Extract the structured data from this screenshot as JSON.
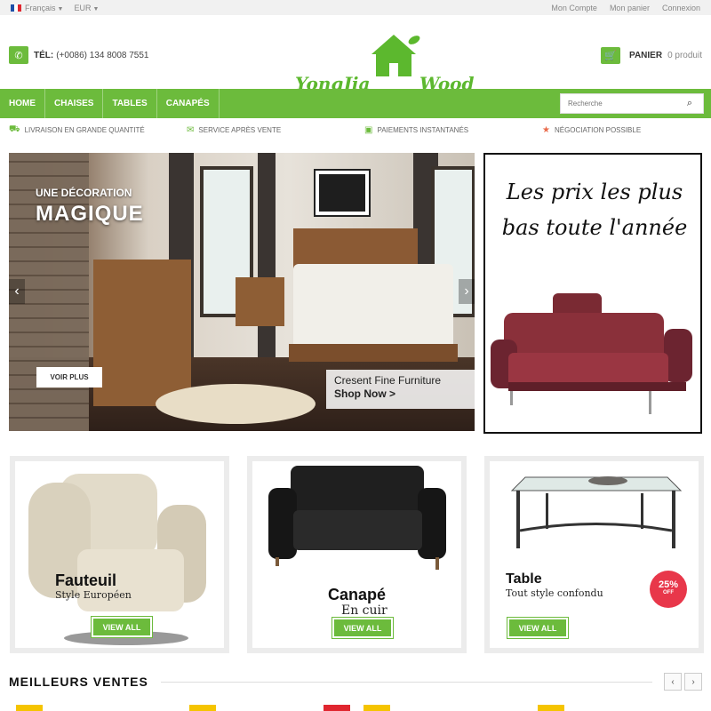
{
  "topbar": {
    "language": "Français",
    "currency": "EUR",
    "links": [
      "Mon Compte",
      "Mon panier",
      "Connexion"
    ]
  },
  "header": {
    "phone_label": "TÉL:",
    "phone_number": "(+0086) 134 8008 7551",
    "logo_text": "YongJia Wood",
    "cart_label": "PANIER",
    "cart_count": "0 produit"
  },
  "nav": {
    "items": [
      "HOME",
      "CHAISES",
      "TABLES",
      "CANAPÉS"
    ],
    "search_placeholder": "Recherche"
  },
  "features": [
    {
      "icon": "truck-icon",
      "label": "LIVRAISON EN GRANDE QUANTITÉ"
    },
    {
      "icon": "chat-icon",
      "label": "SERVICE APRÈS VENTE"
    },
    {
      "icon": "money-icon",
      "label": "PAIEMENTS INSTANTANÉS"
    },
    {
      "icon": "star-icon",
      "label": "NÉGOCIATION POSSIBLE"
    }
  ],
  "banner": {
    "small_title": "UNE DÉCORATION",
    "big_title": "MAGIQUE",
    "button": "VOIR PLUS",
    "brand_line1": "Cresent Fine Furniture",
    "brand_line2": "Shop Now >"
  },
  "promo": {
    "text": "Les prix les plus bas toute l'année"
  },
  "cards": [
    {
      "title": "Fauteuil",
      "subtitle": "Style Européen",
      "button": "VIEW ALL"
    },
    {
      "title": "Canapé",
      "subtitle": "En cuir",
      "button": "VIEW ALL"
    },
    {
      "title": "Table",
      "subtitle": "Tout style confondu",
      "button": "VIEW ALL",
      "badge_pct": "25%",
      "badge_off": "OFF"
    }
  ],
  "best_sellers": {
    "title": "MEILLEURS VENTES"
  },
  "colors": {
    "accent": "#6cbb3c",
    "badge": "#e8374a"
  }
}
